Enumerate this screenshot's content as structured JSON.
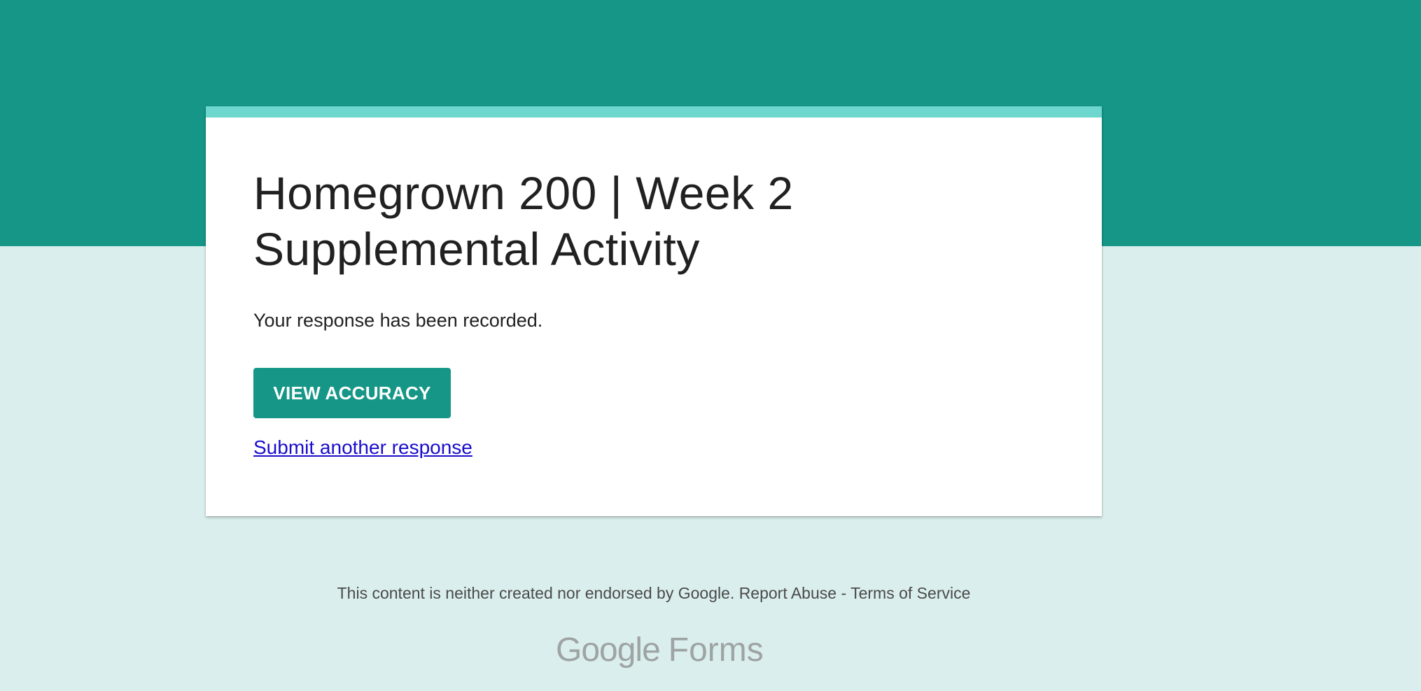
{
  "form": {
    "title": "Homegrown 200 | Week 2 Supplemental Activity",
    "confirmation_message": "Your response has been recorded.",
    "view_accuracy_label": "VIEW ACCURACY",
    "submit_another_label": "Submit another response"
  },
  "footer": {
    "disclaimer": "This content is neither created nor endorsed by Google.",
    "report_abuse_label": "Report Abuse",
    "separator": "-",
    "terms_label": "Terms of Service"
  },
  "branding": {
    "google_wordmark": "Google",
    "product_name": "Forms"
  },
  "colors": {
    "theme_primary": "#169687",
    "theme_accent": "#6ed7cd",
    "page_background": "#daefed",
    "card_background": "#ffffff",
    "link": "#1a0dcc"
  }
}
